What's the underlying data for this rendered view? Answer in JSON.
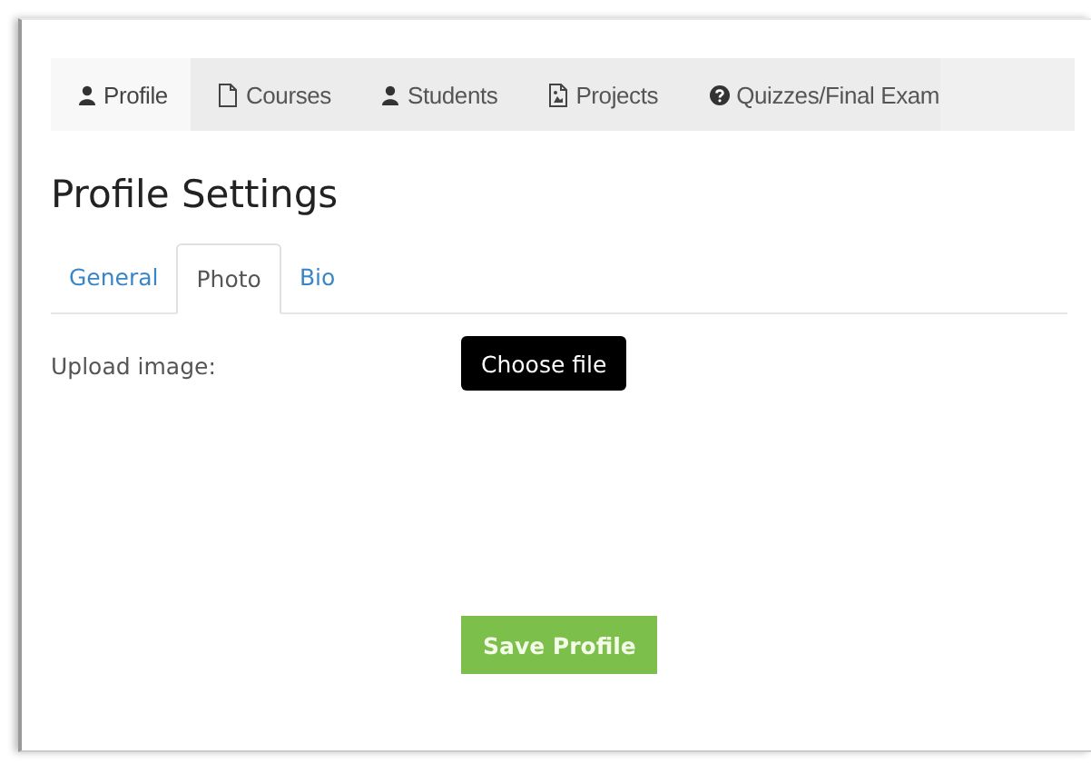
{
  "nav_tabs": [
    {
      "label": "Profile",
      "kind": "user",
      "selected": true
    },
    {
      "label": "Courses",
      "kind": "file",
      "selected": false
    },
    {
      "label": "Students",
      "kind": "user",
      "selected": false
    },
    {
      "label": "Projects",
      "kind": "image",
      "selected": false
    },
    {
      "label": "Quizzes/Final Exam",
      "kind": "help",
      "selected": false
    }
  ],
  "title": "Profile Settings",
  "sub_tabs": [
    {
      "label": "General",
      "selected": false
    },
    {
      "label": "Photo",
      "selected": true
    },
    {
      "label": "Bio",
      "selected": false
    }
  ],
  "upload": {
    "label": "Upload image:",
    "button": "Choose file"
  },
  "save_button": "Save Profile"
}
